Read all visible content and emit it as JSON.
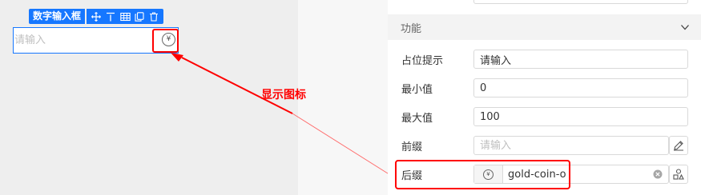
{
  "component": {
    "name": "数字输入框",
    "placeholder": "请输入",
    "suffix_icon": "gold-coin-o",
    "suffix_glyph": "¥"
  },
  "toolbar_icons": [
    "move-icon",
    "align-top-icon",
    "table-icon",
    "copy-icon",
    "delete-icon"
  ],
  "annotation": "显示图标",
  "panel": {
    "section_title": "功能",
    "rows": [
      {
        "label": "占位提示",
        "value": "请输入",
        "placeholder": ""
      },
      {
        "label": "最小值",
        "value": "0",
        "placeholder": ""
      },
      {
        "label": "最大值",
        "value": "100",
        "placeholder": ""
      },
      {
        "label": "前缀",
        "value": "",
        "placeholder": "请输入"
      },
      {
        "label": "后缀",
        "value": "gold-coin-o",
        "placeholder": ""
      }
    ]
  },
  "colors": {
    "accent": "#1677ff",
    "highlight": "#ff0000",
    "canvas_bg": "#eeeeee"
  }
}
